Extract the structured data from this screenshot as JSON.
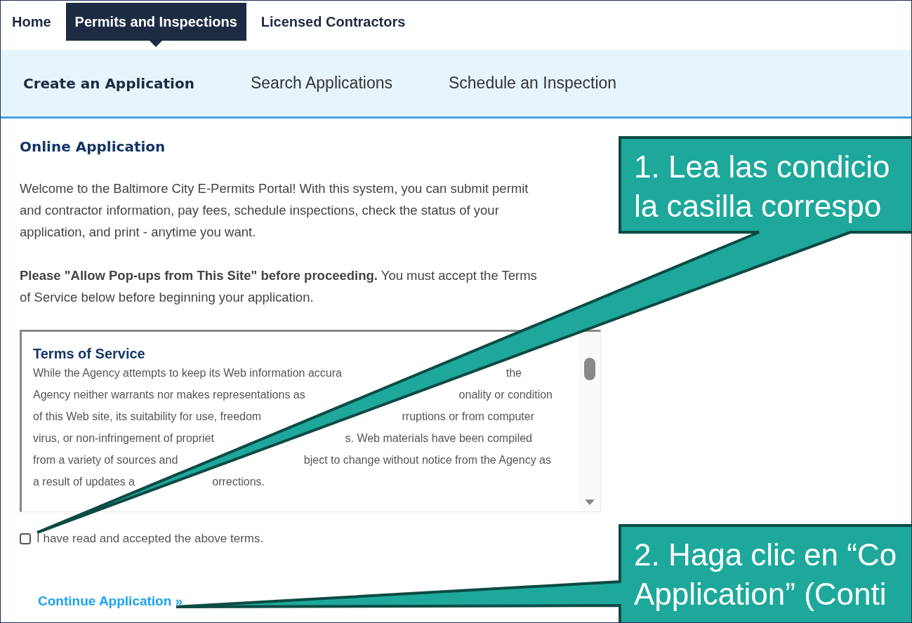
{
  "top_nav": [
    {
      "label": "Home",
      "selected": false
    },
    {
      "label": "Permits and Inspections",
      "selected": true
    },
    {
      "label": "Licensed Contractors",
      "selected": false
    }
  ],
  "sub_nav": [
    {
      "label": "Create an Application",
      "selected": true
    },
    {
      "label": "Search Applications",
      "selected": false
    },
    {
      "label": "Schedule an Inspection",
      "selected": false
    }
  ],
  "heading": "Online Application",
  "paragraphs": [
    "Welcome to the Baltimore City E-Permits Portal! With this system, you can submit permit and contractor information, pay fees, schedule inspections, check the status of your application, and print - anytime you want.",
    "**Please \"Allow Pop-ups from This Site\" before proceeding.** You must accept the Terms of Service below before beginning your application."
  ],
  "terms": {
    "title": "Terms of Service",
    "lines": [
      {
        "left": "While the Agency attempts to keep its Web information accura",
        "right": "the"
      },
      {
        "left": "Agency neither warrants nor makes representations as",
        "right": "onality or condition"
      },
      {
        "left": "of this Web site, its suitability for use, freedom",
        "right": "rruptions or from computer"
      },
      {
        "left": "virus, or non-infringement of propriet",
        "right": "s. Web materials have been compiled"
      },
      {
        "left": "from a variety of sources and",
        "right": "bject to change without notice from the Agency as"
      },
      {
        "left": "a result of updates a",
        "right": "orrections."
      }
    ]
  },
  "accept": {
    "label": "I have read and accepted the above terms.",
    "checked": false
  },
  "continue_link": "Continue Application »",
  "callouts": [
    {
      "lines": [
        "1. Lea las condicio",
        "la casilla correspo"
      ]
    },
    {
      "lines": [
        "2. Haga clic en “Co",
        "Application” (Conti"
      ]
    }
  ]
}
